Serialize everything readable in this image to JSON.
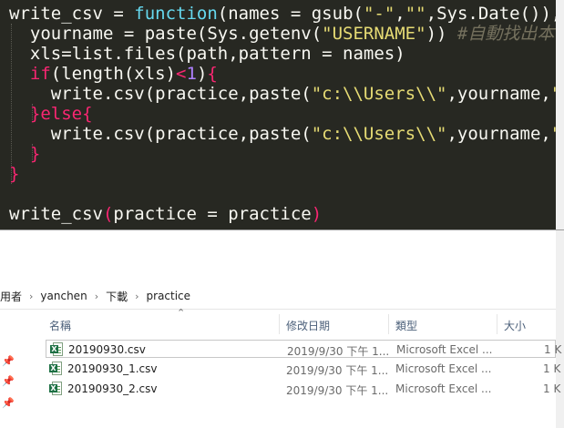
{
  "editor": {
    "lines": [
      {
        "tokens": [
          [
            "b",
            "write_csv = "
          ],
          [
            "f",
            "function"
          ],
          [
            "b",
            "(names = gsub("
          ],
          [
            "s",
            "\"-\""
          ],
          [
            "b",
            ","
          ],
          [
            "s",
            "\"\""
          ],
          [
            "b",
            ",Sys.Date()),pr"
          ]
        ]
      },
      {
        "tokens": [
          [
            "b",
            "  yourname = paste(Sys.getenv("
          ],
          [
            "s",
            "\"USERNAME\""
          ],
          [
            "b",
            ")) "
          ],
          [
            "c",
            "#自動找出本機"
          ]
        ]
      },
      {
        "tokens": [
          [
            "b",
            "  xls=list.files(path,pattern = names)"
          ]
        ]
      },
      {
        "tokens": [
          [
            "k",
            "  if"
          ],
          [
            "b",
            "(length(xls)"
          ],
          [
            "k",
            "<"
          ],
          [
            "n",
            "1"
          ],
          [
            "b",
            ")"
          ],
          [
            "k",
            "{"
          ]
        ]
      },
      {
        "tokens": [
          [
            "b",
            "    write.csv(practice,paste("
          ],
          [
            "s",
            "\"c:\\\\Users\\\\\""
          ],
          [
            "b",
            ",yourname,"
          ],
          [
            "s",
            "\"\\\\"
          ]
        ]
      },
      {
        "tokens": [
          [
            "k",
            "  }else{"
          ]
        ]
      },
      {
        "tokens": [
          [
            "b",
            "    write.csv(practice,paste("
          ],
          [
            "s",
            "\"c:\\\\Users\\\\\""
          ],
          [
            "b",
            ",yourname,"
          ],
          [
            "s",
            "\"\\\\"
          ]
        ]
      },
      {
        "tokens": [
          [
            "k",
            "  }"
          ]
        ]
      },
      {
        "tokens": [
          [
            "k",
            "}"
          ]
        ]
      },
      {
        "tokens": [
          [
            "b",
            ""
          ]
        ]
      },
      {
        "tokens": [
          [
            "b",
            "write_csv"
          ],
          [
            "k",
            "("
          ],
          [
            "b",
            "practice = practice"
          ],
          [
            "k",
            ")"
          ]
        ]
      }
    ]
  },
  "breadcrumb": {
    "items": [
      "用者",
      "yanchen",
      "下載",
      "practice"
    ],
    "separator": "›"
  },
  "columns": {
    "name": "名稱",
    "modified": "修改日期",
    "type": "類型",
    "size": "大小"
  },
  "files": [
    {
      "name": "20190930.csv",
      "modified": "2019/9/30 下午 1...",
      "type": "Microsoft Excel ...",
      "size": "1 K",
      "selected": true
    },
    {
      "name": "20190930_1.csv",
      "modified": "2019/9/30 下午 1...",
      "type": "Microsoft Excel ...",
      "size": "1 K",
      "selected": false
    },
    {
      "name": "20190930_2.csv",
      "modified": "2019/9/30 下午 1...",
      "type": "Microsoft Excel ...",
      "size": "1 K",
      "selected": false
    }
  ],
  "icons": {
    "file_icon": "excel-csv-icon",
    "pin_icon": "pin-icon",
    "sort_icon": "sort-caret-icon"
  },
  "colors": {
    "editor_bg": "#272822",
    "keyword": "#f92672",
    "function": "#66d9ef",
    "string": "#e6db74",
    "comment": "#75715e",
    "number": "#ae81ff"
  }
}
